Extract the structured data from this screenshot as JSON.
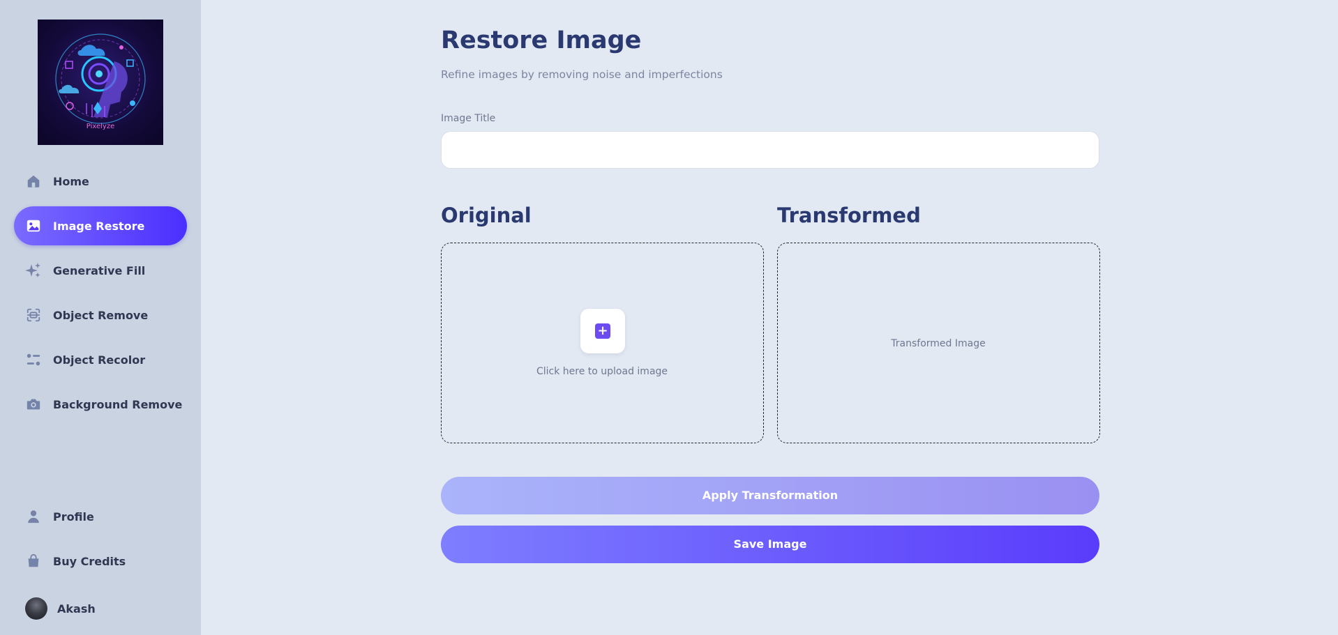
{
  "brand": {
    "name": "Pixelyze"
  },
  "sidebar": {
    "items": [
      {
        "label": "Home",
        "icon": "home-icon"
      },
      {
        "label": "Image Restore",
        "icon": "image-icon",
        "active": true
      },
      {
        "label": "Generative Fill",
        "icon": "sparkles-icon"
      },
      {
        "label": "Object Remove",
        "icon": "scan-icon"
      },
      {
        "label": "Object Recolor",
        "icon": "filter-icon"
      },
      {
        "label": "Background Remove",
        "icon": "camera-icon"
      }
    ],
    "bottom_items": [
      {
        "label": "Profile",
        "icon": "user-icon"
      },
      {
        "label": "Buy Credits",
        "icon": "bag-icon"
      }
    ],
    "user": {
      "name": "Akash"
    }
  },
  "page": {
    "title": "Restore Image",
    "subtitle": "Refine images by removing noise and imperfections"
  },
  "form": {
    "image_title_label": "Image Title",
    "image_title_value": "",
    "image_title_placeholder": ""
  },
  "original": {
    "heading": "Original",
    "upload_text": "Click here to upload image"
  },
  "transformed": {
    "heading": "Transformed",
    "placeholder_text": "Transformed Image"
  },
  "actions": {
    "apply_label": "Apply Transformation",
    "save_label": "Save Image"
  },
  "colors": {
    "accent": "#5b3cfb",
    "accent_light": "#7b6bff",
    "sidebar_bg": "#c9d3e1",
    "page_bg": "#e3e9f3",
    "heading": "#2a3a70"
  }
}
